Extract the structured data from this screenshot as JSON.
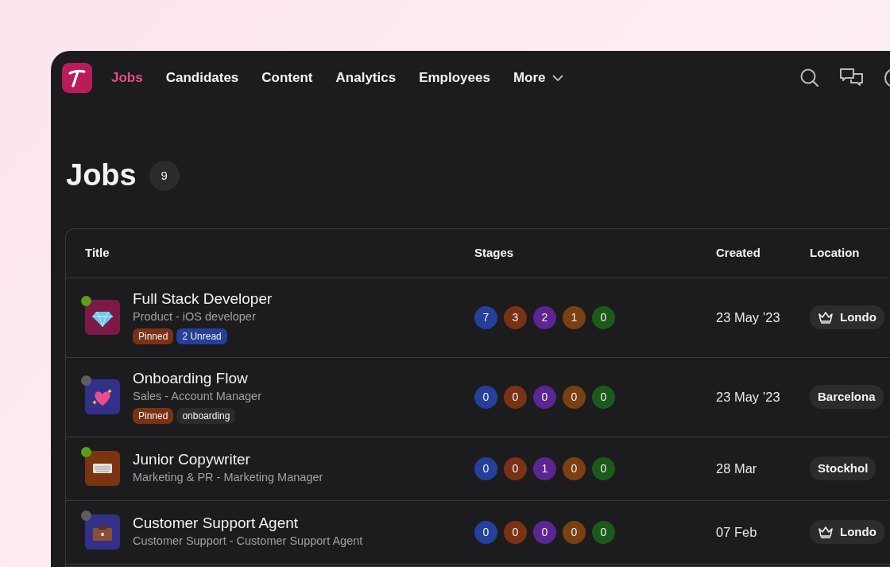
{
  "nav": {
    "items": [
      {
        "label": "Jobs",
        "selected": true
      },
      {
        "label": "Candidates",
        "selected": false
      },
      {
        "label": "Content",
        "selected": false
      },
      {
        "label": "Analytics",
        "selected": false
      },
      {
        "label": "Employees",
        "selected": false
      }
    ],
    "more": "More"
  },
  "page": {
    "title": "Jobs",
    "count": "9"
  },
  "table": {
    "columns": [
      "Title",
      "Stages",
      "Created",
      "Location"
    ],
    "rows": [
      {
        "title": "Full Stack Developer",
        "subtitle": "Product - iOS developer",
        "live": true,
        "tags": [
          {
            "text": "Pinned",
            "color": "#7a3214"
          },
          {
            "text": "2 Unread",
            "color": "#24409a"
          }
        ],
        "stages": [
          {
            "count": "7",
            "color": "#24409a"
          },
          {
            "count": "3",
            "color": "#7a3214"
          },
          {
            "count": "2",
            "color": "#5b2592"
          },
          {
            "count": "1",
            "color": "#7a4012"
          },
          {
            "count": "0",
            "color": "#1b5a1b"
          }
        ],
        "created": "23 May ’23",
        "location": {
          "text": "Londo",
          "crown": true
        }
      },
      {
        "title": "Onboarding Flow",
        "subtitle": "Sales - Account Manager",
        "live": false,
        "tags": [
          {
            "text": "Pinned",
            "color": "#7a3214"
          },
          {
            "text": "onboarding",
            "color": "#2b2b2d"
          }
        ],
        "stages": [
          {
            "count": "0",
            "color": "#24409a"
          },
          {
            "count": "0",
            "color": "#7a3214"
          },
          {
            "count": "0",
            "color": "#5b2592"
          },
          {
            "count": "0",
            "color": "#7a4012"
          },
          {
            "count": "0",
            "color": "#1b5a1b"
          }
        ],
        "created": "23 May ’23",
        "location": {
          "text": "Barcelona",
          "crown": false
        }
      },
      {
        "title": "Junior Copywriter",
        "subtitle": "Marketing & PR - Marketing Manager",
        "live": true,
        "tags": [],
        "stages": [
          {
            "count": "0",
            "color": "#24409a"
          },
          {
            "count": "0",
            "color": "#7a3214"
          },
          {
            "count": "1",
            "color": "#5b2592"
          },
          {
            "count": "0",
            "color": "#7a4012"
          },
          {
            "count": "0",
            "color": "#1b5a1b"
          }
        ],
        "created": "28 Mar",
        "location": {
          "text": "Stockhol",
          "crown": false
        }
      },
      {
        "title": "Customer Support Agent",
        "subtitle": "Customer Support - Customer Support Agent",
        "live": false,
        "tags": [],
        "stages": [
          {
            "count": "0",
            "color": "#24409a"
          },
          {
            "count": "0",
            "color": "#7a3214"
          },
          {
            "count": "0",
            "color": "#5b2592"
          },
          {
            "count": "0",
            "color": "#7a4012"
          },
          {
            "count": "0",
            "color": "#1b5a1b"
          }
        ],
        "created": "07 Feb",
        "location": {
          "text": "Londo",
          "crown": true
        }
      }
    ]
  }
}
